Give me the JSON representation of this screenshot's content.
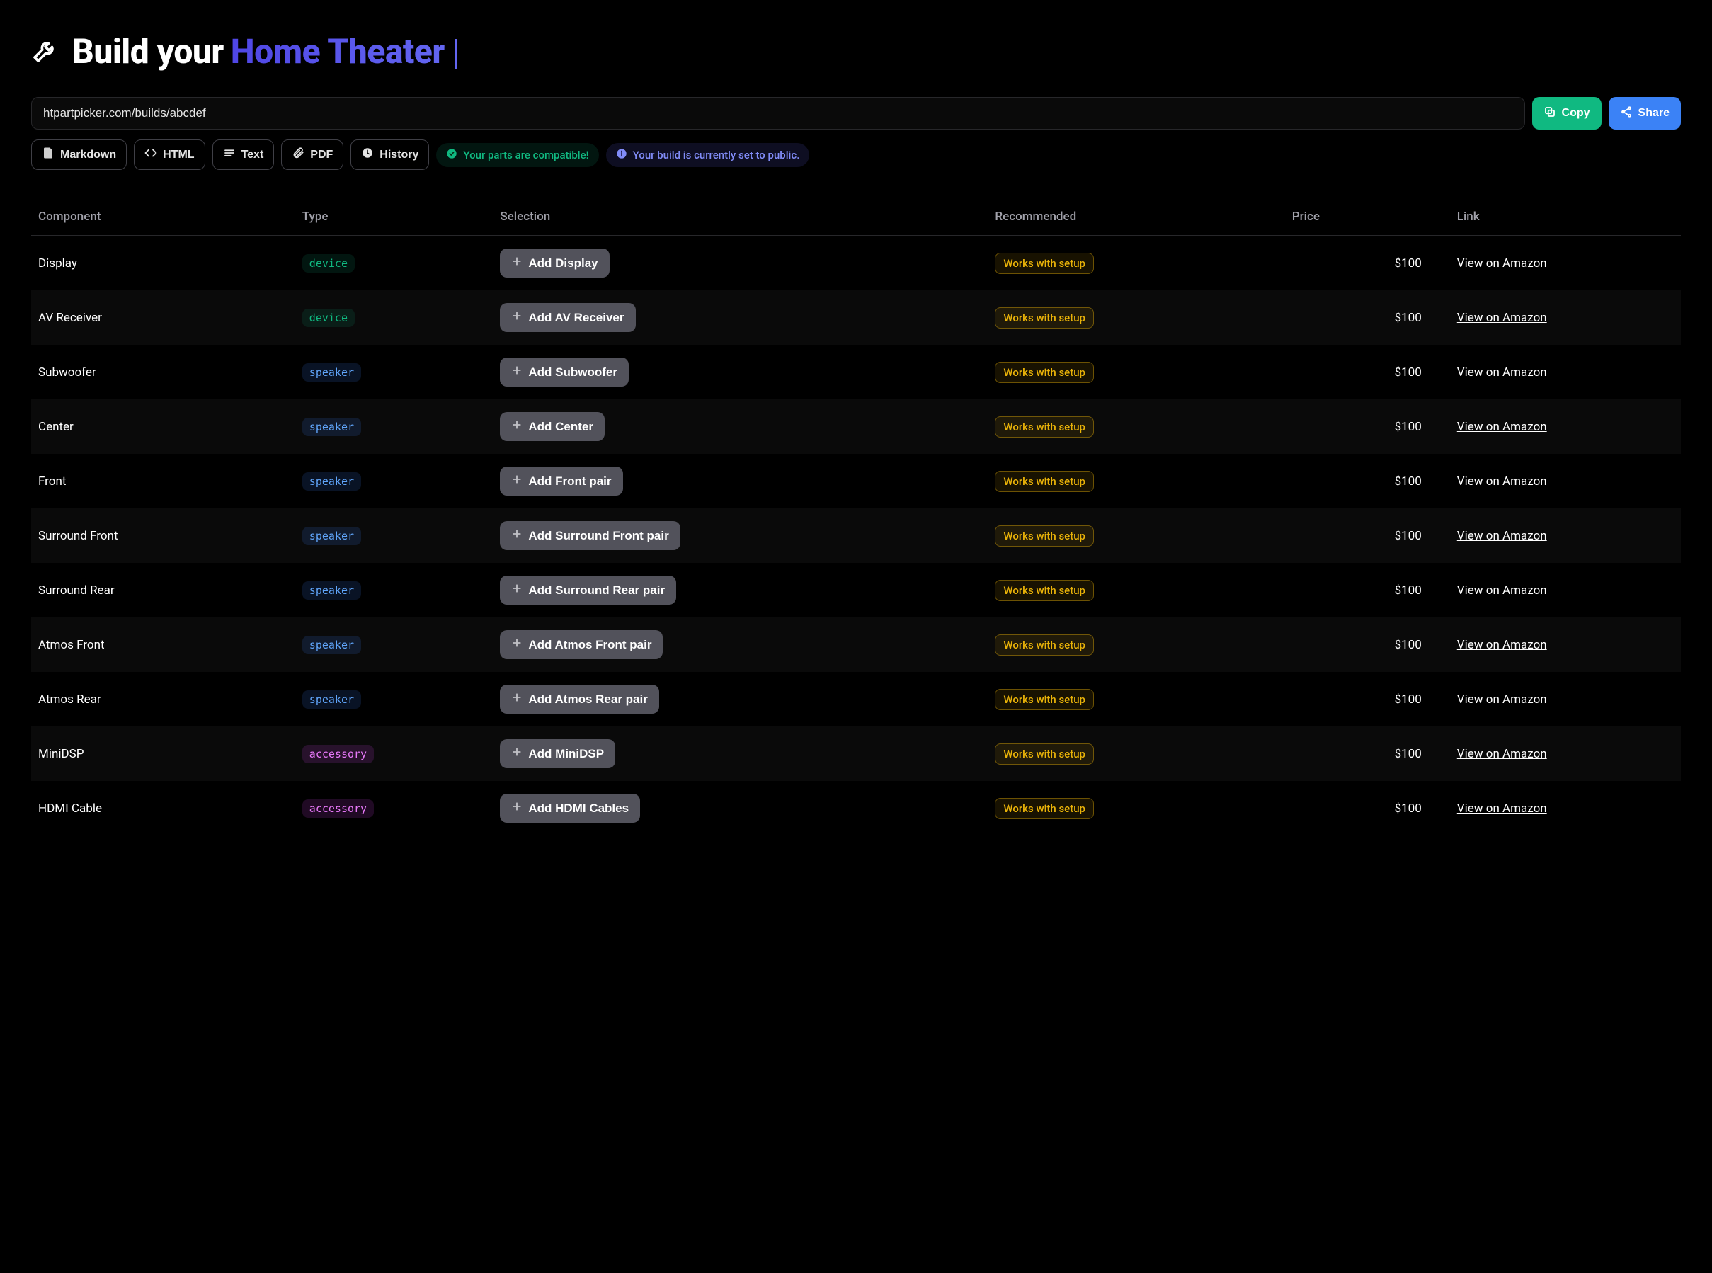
{
  "title": {
    "prefix": "Build your",
    "accent": "Home Theater"
  },
  "url_value": "htpartpicker.com/builds/abcdef",
  "buttons": {
    "copy": "Copy",
    "share": "Share",
    "markdown": "Markdown",
    "html": "HTML",
    "text": "Text",
    "pdf": "PDF",
    "history": "History"
  },
  "status": {
    "compat": "Your parts are compatible!",
    "public": "Your build is currently set to public."
  },
  "table": {
    "headers": {
      "component": "Component",
      "type": "Type",
      "selection": "Selection",
      "recommended": "Recommended",
      "price": "Price",
      "link": "Link"
    },
    "rows": [
      {
        "component": "Display",
        "type": "device",
        "selection_label": "Add Display",
        "recommended": "Works with setup",
        "price": "$100",
        "link": "View on Amazon"
      },
      {
        "component": "AV Receiver",
        "type": "device",
        "selection_label": "Add AV Receiver",
        "recommended": "Works with setup",
        "price": "$100",
        "link": "View on Amazon"
      },
      {
        "component": "Subwoofer",
        "type": "speaker",
        "selection_label": "Add Subwoofer",
        "recommended": "Works with setup",
        "price": "$100",
        "link": "View on Amazon"
      },
      {
        "component": "Center",
        "type": "speaker",
        "selection_label": "Add Center",
        "recommended": "Works with setup",
        "price": "$100",
        "link": "View on Amazon"
      },
      {
        "component": "Front",
        "type": "speaker",
        "selection_label": "Add Front pair",
        "recommended": "Works with setup",
        "price": "$100",
        "link": "View on Amazon"
      },
      {
        "component": "Surround Front",
        "type": "speaker",
        "selection_label": "Add Surround Front pair",
        "recommended": "Works with setup",
        "price": "$100",
        "link": "View on Amazon"
      },
      {
        "component": "Surround Rear",
        "type": "speaker",
        "selection_label": "Add Surround Rear pair",
        "recommended": "Works with setup",
        "price": "$100",
        "link": "View on Amazon"
      },
      {
        "component": "Atmos Front",
        "type": "speaker",
        "selection_label": "Add Atmos Front pair",
        "recommended": "Works with setup",
        "price": "$100",
        "link": "View on Amazon"
      },
      {
        "component": "Atmos Rear",
        "type": "speaker",
        "selection_label": "Add Atmos Rear pair",
        "recommended": "Works with setup",
        "price": "$100",
        "link": "View on Amazon"
      },
      {
        "component": "MiniDSP",
        "type": "accessory",
        "selection_label": "Add MiniDSP",
        "recommended": "Works with setup",
        "price": "$100",
        "link": "View on Amazon"
      },
      {
        "component": "HDMI Cable",
        "type": "accessory",
        "selection_label": "Add HDMI Cables",
        "recommended": "Works with setup",
        "price": "$100",
        "link": "View on Amazon"
      }
    ]
  }
}
